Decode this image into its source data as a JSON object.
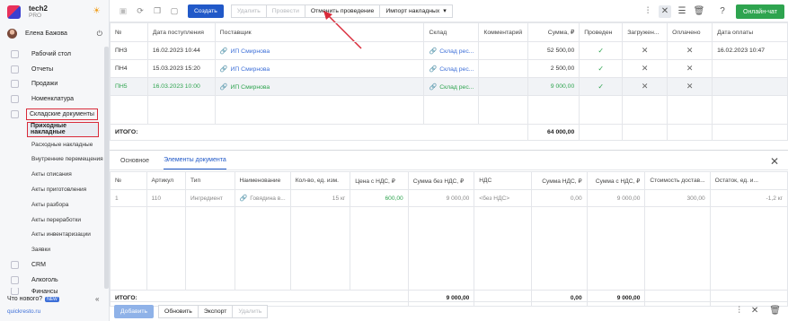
{
  "brand": {
    "name": "tech2",
    "plan": "PRO"
  },
  "user": {
    "name": "Елена Бажова"
  },
  "nav": [
    {
      "label": "Рабочий стол",
      "icon": "desktop-icon"
    },
    {
      "label": "Отчеты",
      "icon": "reports-icon"
    },
    {
      "label": "Продажи",
      "icon": "sales-icon"
    },
    {
      "label": "Номенклатура",
      "icon": "nomenclature-icon"
    },
    {
      "label": "Складские документы",
      "icon": "warehouse-icon"
    },
    {
      "label": "Приходные накладные"
    },
    {
      "label": "Расходные накладные"
    },
    {
      "label": "Внутренние перемещения"
    },
    {
      "label": "Акты списания"
    },
    {
      "label": "Акты приготовления"
    },
    {
      "label": "Акты разбора"
    },
    {
      "label": "Акты переработки"
    },
    {
      "label": "Акты инвентаризации"
    },
    {
      "label": "Заявки"
    },
    {
      "label": "CRM",
      "icon": "crm-icon"
    },
    {
      "label": "Алкоголь",
      "icon": "alcohol-icon"
    },
    {
      "label": "Финансы",
      "icon": "finance-icon"
    }
  ],
  "footer": {
    "news": "Что нового?",
    "news_badge": "NEW",
    "site": "quickresto.ru"
  },
  "toolbar": {
    "create": "Создать",
    "delete": "Удалить",
    "post": "Провести",
    "unpost": "Отменить проведение",
    "import": "Импорт накладных",
    "chat": "Онлайн-чат"
  },
  "table": {
    "headers": [
      "№",
      "Дата поступления",
      "Поставщик",
      "Склад",
      "Комментарий",
      "Сумма, ₽",
      "Проведен",
      "Загружен...",
      "Оплачено",
      "Дата оплаты"
    ],
    "rows": [
      {
        "num": "ПН3",
        "date": "16.02.2023 10:44",
        "supplier": "ИП Смирнова",
        "store": "Склад рес...",
        "comment": "",
        "sum": "52 500,00",
        "posted": true,
        "loaded": false,
        "paid": false,
        "paydate": "16.02.2023 10:47"
      },
      {
        "num": "ПН4",
        "date": "15.03.2023 15:20",
        "supplier": "ИП Смирнова",
        "store": "Склад рес...",
        "comment": "",
        "sum": "2 500,00",
        "posted": true,
        "loaded": false,
        "paid": false,
        "paydate": ""
      },
      {
        "num": "ПН5",
        "date": "16.03.2023 10:00",
        "supplier": "ИП Смирнова",
        "store": "Склад рес...",
        "comment": "",
        "sum": "9 000,00",
        "posted": true,
        "loaded": false,
        "paid": false,
        "paydate": ""
      }
    ],
    "total_label": "ИТОГО:",
    "total_sum": "64 000,00"
  },
  "detail": {
    "tabs": [
      "Основное",
      "Элементы документа"
    ],
    "headers": [
      "№",
      "Артикул",
      "Тип",
      "Наименование",
      "Кол-во, ед. изм.",
      "Цена с НДС, ₽",
      "Сумма без НДС, ₽",
      "НДС",
      "Сумма НДС, ₽",
      "Сумма с НДС, ₽",
      "Стоимость достав...",
      "Остаток, ед. и..."
    ],
    "row": {
      "num": "1",
      "article": "110",
      "type": "Ингредиент",
      "name": "Говядина в...",
      "qty": "15 кг",
      "price": "600,00",
      "sum_wo": "9 000,00",
      "vat": "<без НДС>",
      "vat_sum": "0,00",
      "sum_w": "9 000,00",
      "delivery": "300,00",
      "rest": "-1,2 кг"
    },
    "total_label": "ИТОГО:",
    "total_wo": "9 000,00",
    "total_vat": "0,00",
    "total_w": "9 000,00"
  },
  "bottom": {
    "add": "Добавить",
    "refresh": "Обновить",
    "export": "Экспорт",
    "delete": "Удалить"
  }
}
